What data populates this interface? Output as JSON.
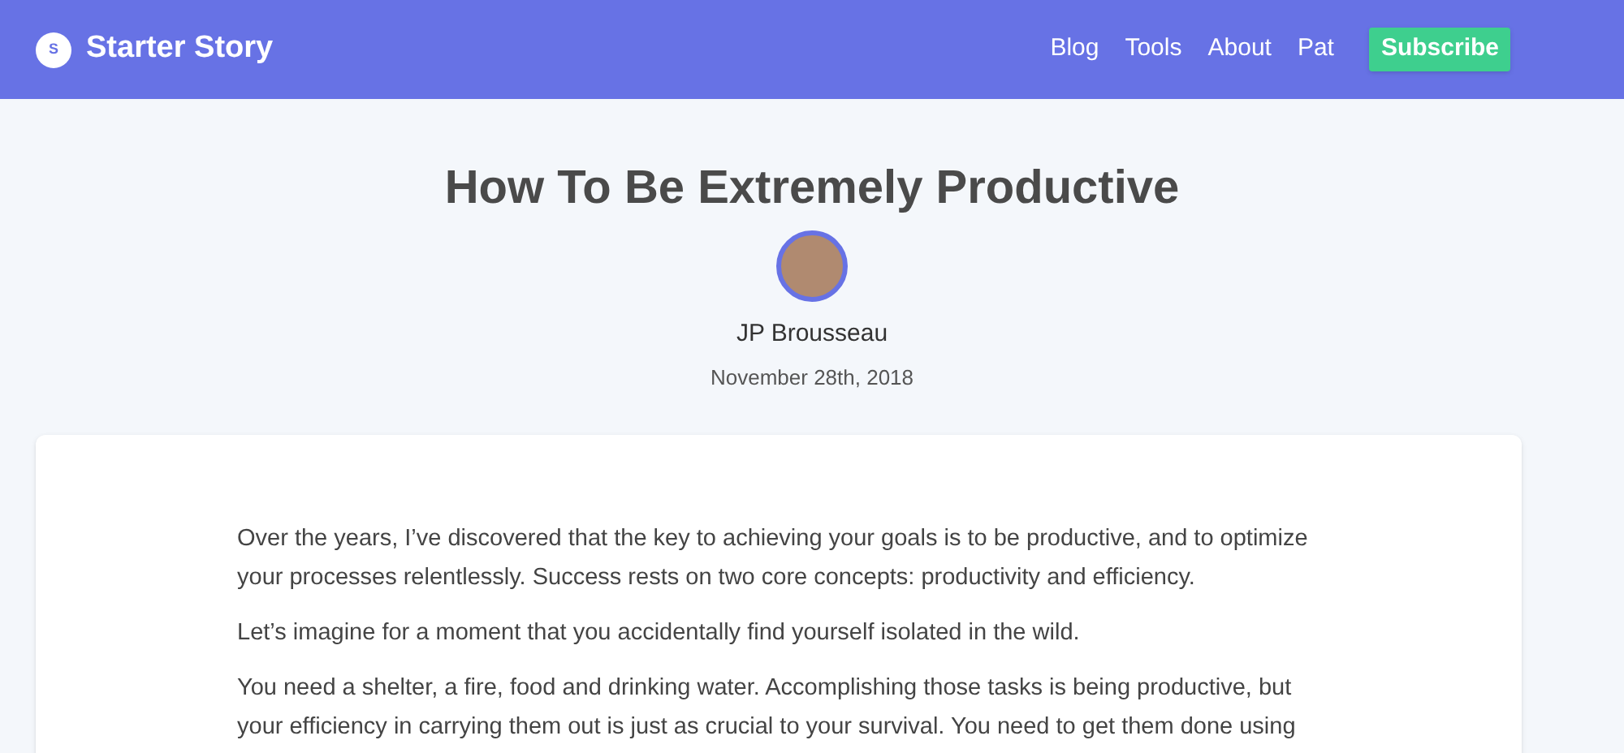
{
  "header": {
    "logo_letter": "S",
    "brand": "Starter Story",
    "nav": [
      "Blog",
      "Tools",
      "About",
      "Pat"
    ],
    "cta": "Subscribe"
  },
  "article": {
    "title": "How To Be Extremely Productive",
    "author": "JP Brousseau",
    "date": "November 28th, 2018",
    "paragraphs": [
      "Over the years, I’ve discovered that the key to achieving your goals is to be productive, and to optimize your processes relentlessly. Success rests on two core concepts: productivity and efficiency.",
      "Let’s imagine for a moment that you accidentally find yourself isolated in the wild.",
      "You need a shelter, a fire, food and drinking water. Accomplishing those tasks is being productive, but your efficiency in carrying them out is just as crucial to your survival. You need to get them done using"
    ]
  }
}
